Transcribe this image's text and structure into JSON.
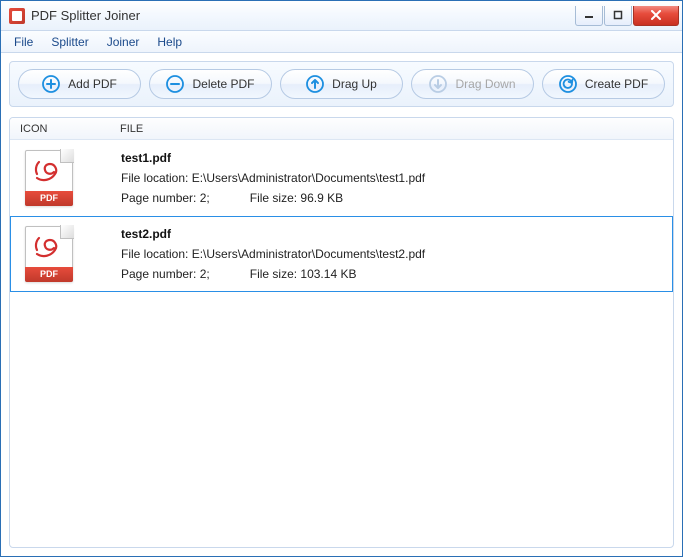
{
  "window": {
    "title": "PDF Splitter Joiner"
  },
  "menu": {
    "file": "File",
    "splitter": "Splitter",
    "joiner": "Joiner",
    "help": "Help"
  },
  "toolbar": {
    "add_label": "Add PDF",
    "delete_label": "Delete PDF",
    "dragup_label": "Drag Up",
    "dragdown_label": "Drag Down",
    "create_label": "Create PDF"
  },
  "columns": {
    "icon": "ICON",
    "file": "FILE"
  },
  "labels": {
    "file_location_prefix": "File location: ",
    "page_number_prefix": "Page number: ",
    "file_size_prefix": "File size: ",
    "pdf_badge": "PDF"
  },
  "files": [
    {
      "name": "test1.pdf",
      "location": "E:\\Users\\Administrator\\Documents\\test1.pdf",
      "pages": "2;",
      "size": "96.9 KB",
      "selected": false
    },
    {
      "name": "test2.pdf",
      "location": "E:\\Users\\Administrator\\Documents\\test2.pdf",
      "pages": "2;",
      "size": "103.14 KB",
      "selected": true
    }
  ],
  "colors": {
    "accent": "#2a8fe6"
  }
}
